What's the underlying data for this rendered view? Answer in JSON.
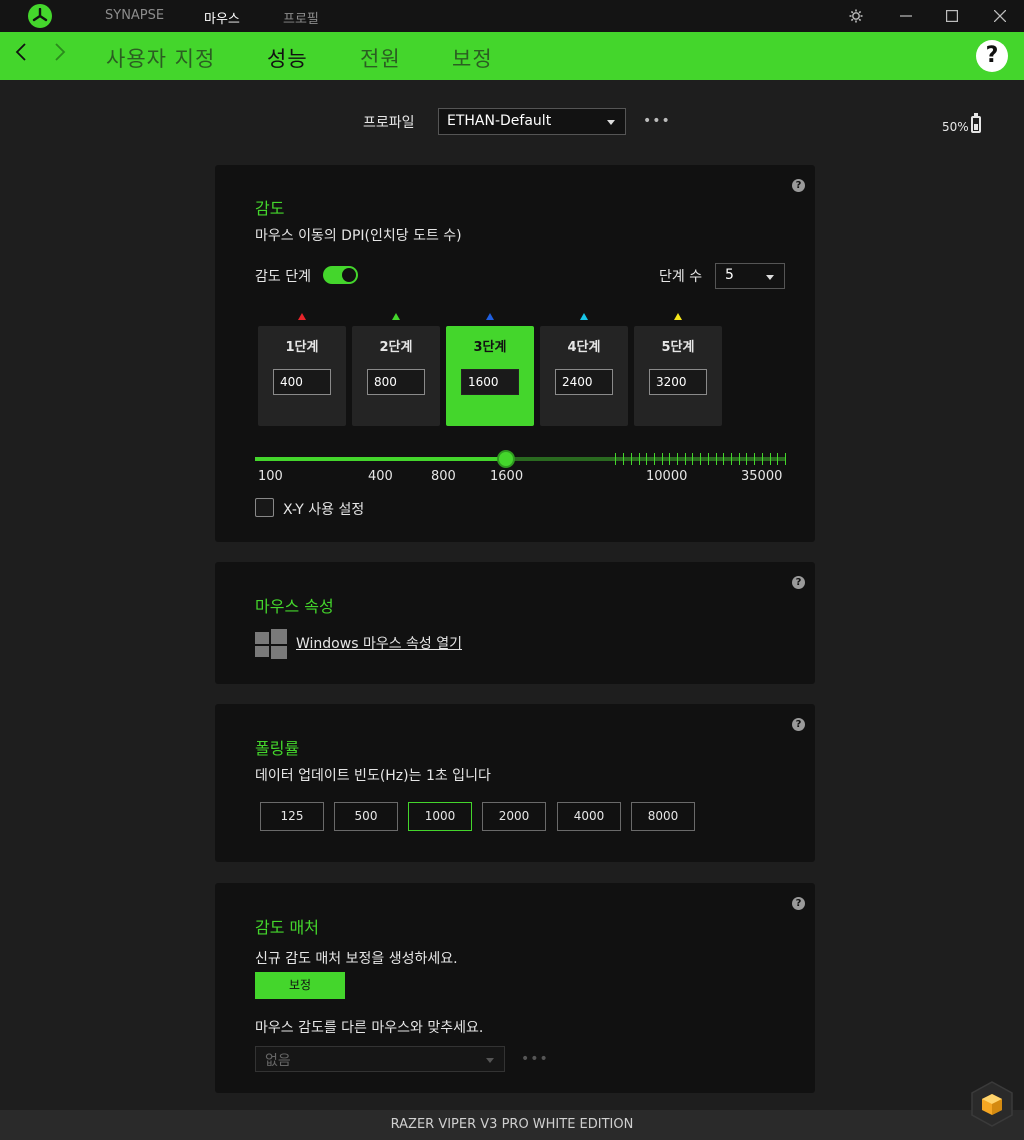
{
  "titlebar": {
    "tabs": [
      "SYNAPSE",
      "마우스",
      "프로필"
    ],
    "active_tab": "마우스"
  },
  "navbar": {
    "tabs": [
      "사용자 지정",
      "성능",
      "전원",
      "보정"
    ],
    "active_tab": "성능",
    "help": "?"
  },
  "profile": {
    "label": "프로파일",
    "value": "ETHAN-Default",
    "more": "•••"
  },
  "battery": {
    "text": "50%",
    "level": 0.5
  },
  "sensitivity": {
    "title": "감도",
    "subtitle": "마우스 이동의 DPI(인치당 도트 수)",
    "stages_label": "감도 단계",
    "stages_enabled": true,
    "stage_count_label": "단계 수",
    "stage_count": "5",
    "stages": [
      {
        "label": "1단계",
        "value": "400",
        "color": "#e8242a",
        "active": false
      },
      {
        "label": "2단계",
        "value": "800",
        "color": "#44d62c",
        "active": false
      },
      {
        "label": "3단계",
        "value": "1600",
        "color": "#1f5fe0",
        "active": true
      },
      {
        "label": "4단계",
        "value": "2400",
        "color": "#18c6e8",
        "active": false
      },
      {
        "label": "5단계",
        "value": "3200",
        "color": "#f5e61a",
        "active": false
      }
    ],
    "slider": {
      "min": 100,
      "max": 35000,
      "value": 1600,
      "labels": [
        "100",
        "400",
        "800",
        "1600",
        "10000",
        "35000"
      ]
    },
    "xy_label": "X-Y 사용 설정",
    "xy_checked": false
  },
  "mouse_properties": {
    "title": "마우스 속성",
    "link": "Windows 마우스 속성 열기"
  },
  "polling": {
    "title": "폴링률",
    "subtitle": "데이터 업데이트 빈도(Hz)는 1초 입니다",
    "options": [
      "125",
      "500",
      "1000",
      "2000",
      "4000",
      "8000"
    ],
    "selected": "1000"
  },
  "matcher": {
    "title": "감도 매처",
    "create_text": "신규 감도 매처 보정을 생성하세요.",
    "calibrate_label": "보정",
    "match_text": "마우스 감도를 다른 마우스와 맞추세요.",
    "select_value": "없음",
    "more": "•••"
  },
  "device_name": "RAZER VIPER V3 PRO WHITE EDITION",
  "colors": {
    "accent": "#44d62c",
    "background": "#1e1e1e",
    "card": "#111111"
  }
}
